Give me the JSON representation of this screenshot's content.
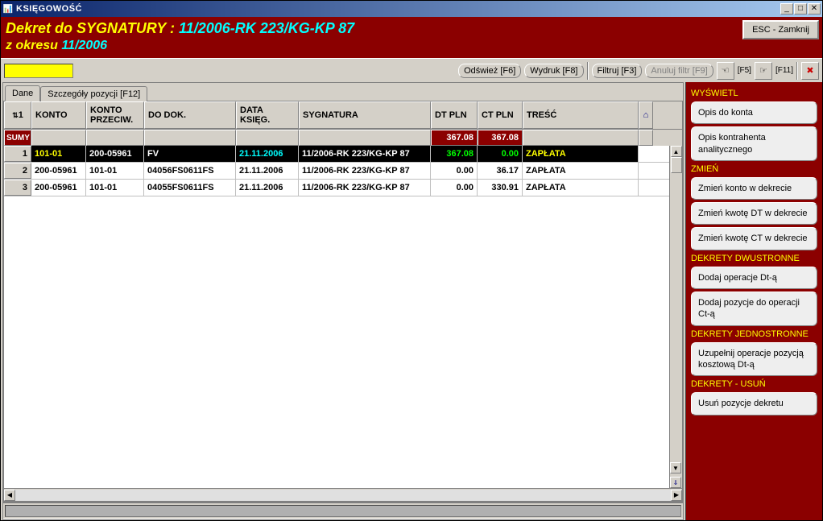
{
  "window": {
    "title": "KSIĘGOWOŚĆ"
  },
  "header": {
    "label1": "Dekret do SYGNATURY  : ",
    "sygnatura": "11/2006-RK 223/KG-KP 87",
    "label2": "z okresu   ",
    "okres": "11/2006",
    "close_label": "ESC - Zamknij"
  },
  "toolbar": {
    "refresh": "Odśwież [F6]",
    "print": "Wydruk [F8]",
    "filter": "Filtruj [F3]",
    "cancel_filter": "Anuluj filtr [F9]",
    "f5_label": "[F5]",
    "f11_label": "[F11]"
  },
  "tabs": {
    "dane": "Dane",
    "szczegoly": "Szczegóły pozycji [F12]"
  },
  "grid": {
    "sort_indicator": "1",
    "headers": {
      "konto": "KONTO",
      "konto_przeciw": "KONTO PRZECIW.",
      "do_dok": "DO DOK.",
      "data_ksieg": "DATA KSIĘG.",
      "sygnatura": "SYGNATURA",
      "dt_pln": "DT PLN",
      "ct_pln": "CT PLN",
      "tresc": "TREŚĆ"
    },
    "sum_label": "SUMY",
    "sum_dt": "367.08",
    "sum_ct": "367.08",
    "rows": [
      {
        "n": "1",
        "konto": "101-01",
        "kontop": "200-05961",
        "dok": "FV",
        "data": "21.11.2006",
        "syg": "11/2006-RK 223/KG-KP 87",
        "dt": "367.08",
        "ct": "0.00",
        "tresc": "ZAPŁATA"
      },
      {
        "n": "2",
        "konto": "200-05961",
        "kontop": "101-01",
        "dok": "04056FS0611FS",
        "data": "21.11.2006",
        "syg": "11/2006-RK 223/KG-KP 87",
        "dt": "0.00",
        "ct": "36.17",
        "tresc": "ZAPŁATA"
      },
      {
        "n": "3",
        "konto": "200-05961",
        "kontop": "101-01",
        "dok": "04055FS0611FS",
        "data": "21.11.2006",
        "syg": "11/2006-RK 223/KG-KP 87",
        "dt": "0.00",
        "ct": "330.91",
        "tresc": "ZAPŁATA"
      }
    ]
  },
  "sidebar": {
    "sec_wyswietl": "WYŚWIETL",
    "btn_opis_konta": "Opis do konta",
    "btn_opis_kontrahenta": "Opis kontrahenta analitycznego",
    "sec_zmien": "ZMIEŃ",
    "btn_zmien_konto": "Zmień konto w dekrecie",
    "btn_zmien_dt": "Zmień kwotę DT w dekrecie",
    "btn_zmien_ct": "Zmień kwotę CT w dekrecie",
    "sec_dwustronne": "DEKRETY DWUSTRONNE",
    "btn_dodaj_dt": "Dodaj operacje Dt-ą",
    "btn_dodaj_ct": "Dodaj pozycje do operacji Ct-ą",
    "sec_jednostronne": "DEKRETY JEDNOSTRONNE",
    "btn_uzupelnij": "Uzupełnij operacje pozycją kosztową Dt-ą",
    "sec_usun": "DEKRETY - USUŃ",
    "btn_usun": "Usuń pozycje dekretu"
  }
}
